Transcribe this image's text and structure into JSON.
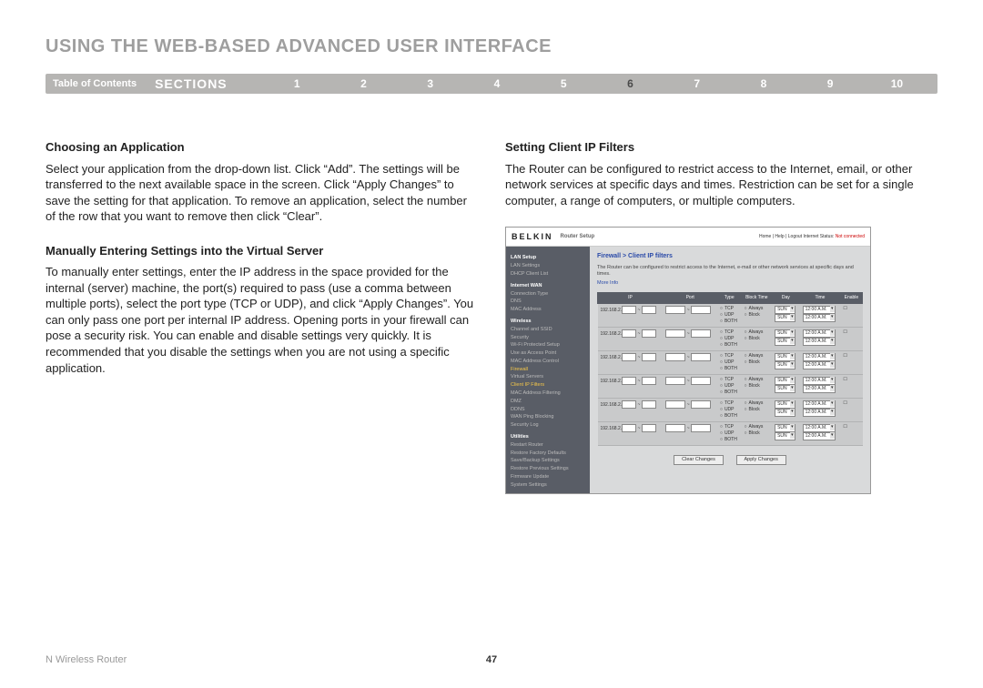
{
  "title": "USING THE WEB-BASED ADVANCED USER INTERFACE",
  "nav": {
    "toc": "Table of Contents",
    "sections": "SECTIONS",
    "nums": [
      "1",
      "2",
      "3",
      "4",
      "5",
      "6",
      "7",
      "8",
      "9",
      "10"
    ],
    "active": 5
  },
  "left": {
    "h1": "Choosing an Application",
    "p1": "Select your application from the drop-down list. Click “Add”. The settings will be transferred to the next available space in the screen. Click “Apply Changes” to save the setting for that application. To remove an application, select the number of the row that you want to remove then click “Clear”.",
    "h2": "Manually Entering Settings into the Virtual Server",
    "p2": "To manually enter settings, enter the IP address in the space provided for the internal (server) machine, the port(s) required to pass (use a comma between multiple ports), select the port type (TCP or UDP), and click “Apply Changes”. You can only pass one port per internal IP address. Opening ports in your firewall can pose a security risk. You can enable and disable settings very quickly. It is recommended that you disable the settings when you are not using a specific application."
  },
  "right": {
    "h1": "Setting Client IP Filters",
    "p1": "The Router can be configured to restrict access to the Internet, email, or other network services at specific days and times. Restriction can be set for a single computer, a range of computers, or multiple computers."
  },
  "shot": {
    "logo": "BELKIN",
    "rs": "Router Setup",
    "headerlinks": "Home | Help | Logout   Internet Status:",
    "nc": "Not connected",
    "side": [
      {
        "t": "LAN Setup",
        "c": "hd"
      },
      {
        "t": "LAN Settings",
        "c": "nm"
      },
      {
        "t": "DHCP Client List",
        "c": "nm"
      },
      {
        "t": "Internet WAN",
        "c": "hd"
      },
      {
        "t": "Connection Type",
        "c": "nm"
      },
      {
        "t": "DNS",
        "c": "nm"
      },
      {
        "t": "MAC Address",
        "c": "nm"
      },
      {
        "t": "Wireless",
        "c": "hd"
      },
      {
        "t": "Channel and SSID",
        "c": "nm"
      },
      {
        "t": "Security",
        "c": "nm"
      },
      {
        "t": "Wi-Fi Protected Setup",
        "c": "nm"
      },
      {
        "t": "Use as Access Point",
        "c": "nm"
      },
      {
        "t": "MAC Address Control",
        "c": "nm"
      },
      {
        "t": "Firewall",
        "c": "hl"
      },
      {
        "t": "Virtual Servers",
        "c": "nm"
      },
      {
        "t": "Client IP Filters",
        "c": "hl"
      },
      {
        "t": "MAC Address Filtering",
        "c": "nm"
      },
      {
        "t": "DMZ",
        "c": "nm"
      },
      {
        "t": "DDNS",
        "c": "nm"
      },
      {
        "t": "WAN Ping Blocking",
        "c": "nm"
      },
      {
        "t": "Security Log",
        "c": "nm"
      },
      {
        "t": "Utilities",
        "c": "hd"
      },
      {
        "t": "Restart Router",
        "c": "nm"
      },
      {
        "t": "Restore Factory Defaults",
        "c": "nm"
      },
      {
        "t": "Save/Backup Settings",
        "c": "nm"
      },
      {
        "t": "Restore Previous Settings",
        "c": "nm"
      },
      {
        "t": "Firmware Update",
        "c": "nm"
      },
      {
        "t": "System Settings",
        "c": "nm"
      }
    ],
    "crumb": "Firewall > Client IP filters",
    "note": "The Router can be configured to restrict access to the Internet, e-mail or other network services at specific days and times.",
    "moreinfo": "More Info",
    "th": [
      "IP",
      "Port",
      "Type",
      "Block Time",
      "Day",
      "Time",
      "Enable"
    ],
    "ip_prefix": "192.168.2.",
    "type_opts": [
      "TCP",
      "UDP",
      "BOTH"
    ],
    "bt_opts": [
      "Always",
      "Block"
    ],
    "day": "SUN",
    "time": "12:00 A.M.",
    "rows": 6,
    "btn1": "Clear Changes",
    "btn2": "Apply Changes"
  },
  "footer": {
    "left": "N Wireless Router",
    "page": "47"
  }
}
